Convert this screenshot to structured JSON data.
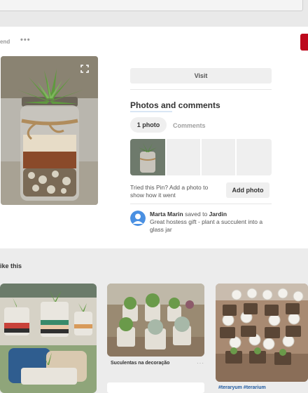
{
  "header": {
    "send_label": "end",
    "more_label": "•••"
  },
  "pin": {
    "expand_icon": "expand-icon"
  },
  "actions": {
    "visit_label": "Visit"
  },
  "photos": {
    "title": "Photos and comments",
    "tabs": [
      {
        "label": "1 photo",
        "active": true
      },
      {
        "label": "Comments",
        "active": false
      }
    ],
    "tried_text": "Tried this Pin? Add a photo to show how it went",
    "add_photo_label": "Add photo"
  },
  "saved_by": {
    "user": "Marta Marin",
    "action": " saved to ",
    "board": "Jardin",
    "note": "Great hostess gift - plant a succulent into a glass jar"
  },
  "more_like_this": {
    "title": "ike this",
    "items": [
      {
        "caption": ""
      },
      {
        "caption": "Suculentas na decoração",
        "more": "···"
      },
      {
        "caption": "#teraryum #terarium"
      }
    ]
  },
  "colors": {
    "save_red": "#bd081c",
    "link_blue": "#1f5aa0",
    "avatar_blue": "#4a90e2"
  }
}
